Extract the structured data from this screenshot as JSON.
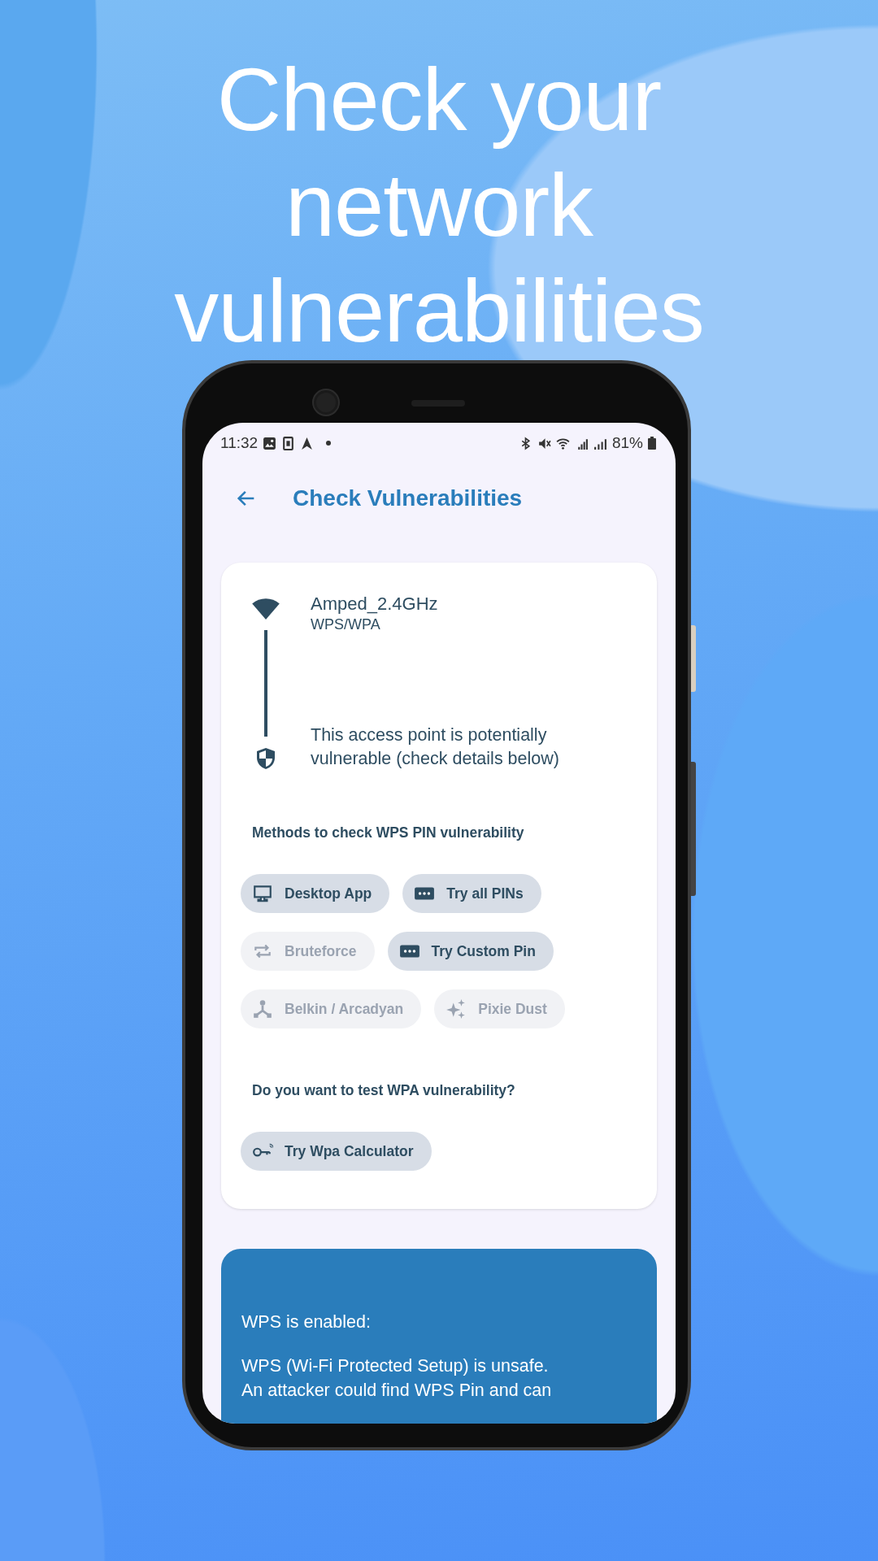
{
  "headline": "Check your network vulnerabilities",
  "status_bar": {
    "time": "11:32",
    "battery": "81%"
  },
  "toolbar": {
    "title": "Check Vulnerabilities"
  },
  "network": {
    "ssid": "Amped_2.4GHz",
    "security": "WPS/WPA",
    "verdict": "This access point is potentially vulnerable (check details below)"
  },
  "wps_methods": {
    "heading": "Methods to check WPS PIN vulnerability",
    "chips": [
      {
        "label": "Desktop App",
        "kind": "monitor",
        "disabled": false
      },
      {
        "label": "Try all PINs",
        "kind": "pin",
        "disabled": false
      },
      {
        "label": "Bruteforce",
        "kind": "repeat",
        "disabled": true
      },
      {
        "label": "Try Custom Pin",
        "kind": "pin",
        "disabled": false
      },
      {
        "label": "Belkin / Arcadyan",
        "kind": "fork",
        "disabled": true
      },
      {
        "label": "Pixie Dust",
        "kind": "sparkle",
        "disabled": true
      }
    ]
  },
  "wpa": {
    "heading": "Do you want to test WPA vulnerability?",
    "chips": [
      {
        "label": "Try Wpa Calculator",
        "kind": "key",
        "disabled": false
      }
    ]
  },
  "info_panel": {
    "title": "WPS is enabled:",
    "lines": [
      "WPS (Wi-Fi Protected Setup) is unsafe.",
      "An attacker could find WPS Pin and can"
    ]
  }
}
